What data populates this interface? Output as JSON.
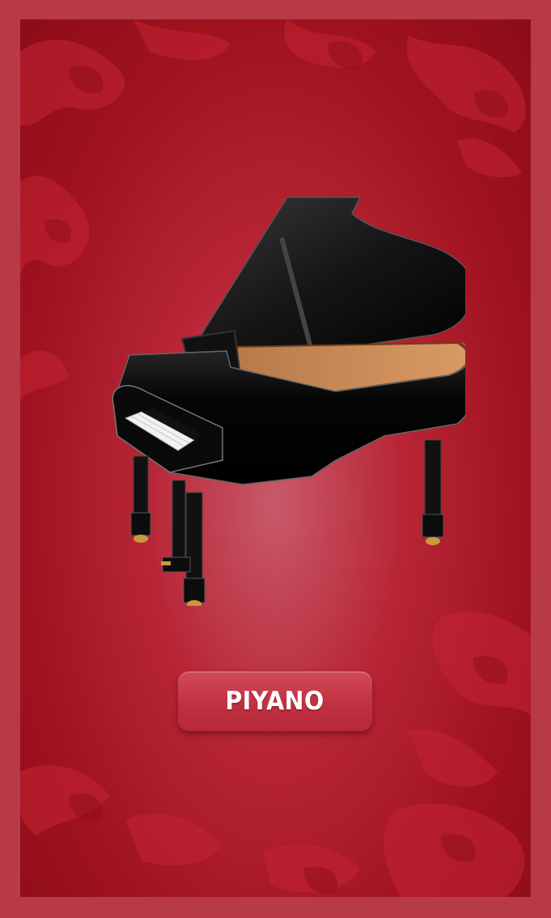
{
  "app": {
    "screen": "splash",
    "title_button_label": "PIYANO",
    "illustration": "grand-piano-icon"
  },
  "colors": {
    "frame": "#b83a48",
    "background_center": "#c85a6a",
    "background_edge": "#8c0c18",
    "button": "#c33a4b",
    "button_text": "#ffffff"
  }
}
